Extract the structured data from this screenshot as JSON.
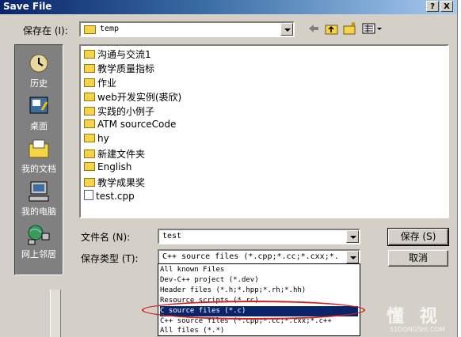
{
  "window": {
    "title": "Save File",
    "help_glyph": "?",
    "close_glyph": "X"
  },
  "save_in": {
    "label": "保存在 (I):",
    "folder": "temp"
  },
  "places": [
    {
      "label": "历史",
      "icon": "history-icon"
    },
    {
      "label": "桌面",
      "icon": "desktop-icon"
    },
    {
      "label": "我的文档",
      "icon": "my-documents-icon"
    },
    {
      "label": "我的电脑",
      "icon": "my-computer-icon"
    },
    {
      "label": "网上邻居",
      "icon": "network-icon"
    }
  ],
  "files": [
    {
      "name": "沟通与交流1",
      "type": "folder"
    },
    {
      "name": "教学质量指标",
      "type": "folder"
    },
    {
      "name": "作业",
      "type": "folder"
    },
    {
      "name": "web开发实例(裘欣)",
      "type": "folder"
    },
    {
      "name": "实践的小例子",
      "type": "folder"
    },
    {
      "name": "ATM sourceCode",
      "type": "folder"
    },
    {
      "name": "hy",
      "type": "folder"
    },
    {
      "name": "新建文件夹",
      "type": "folder"
    },
    {
      "name": "English",
      "type": "folder"
    },
    {
      "name": "教学成果奖",
      "type": "folder"
    },
    {
      "name": "test.cpp",
      "type": "cpp"
    }
  ],
  "filename": {
    "label": "文件名 (N):",
    "value": "test"
  },
  "filetype": {
    "label": "保存类型 (T):",
    "value": "C++ source files (*.cpp;*.cc;*.cxx;*.",
    "options": [
      "All known Files",
      "Dev-C++ project (*.dev)",
      "Header files (*.h;*.hpp;*.rh;*.hh)",
      "Resource scripts (*.rc)",
      "C source files (*.c)",
      "C++ source files (*.cpp;*.cc;*.cxx;*.c++",
      "All files (*.*)"
    ],
    "selected_index": 4
  },
  "buttons": {
    "save": "保存 (S)",
    "cancel": "取消"
  },
  "watermark": {
    "brand": "懂 视",
    "domain": "51DONGSHI.COM"
  },
  "colors": {
    "titlebar_start": "#0a246a",
    "titlebar_end": "#a6caf0",
    "highlight": "#0a246a",
    "annotation": "#d02020"
  }
}
